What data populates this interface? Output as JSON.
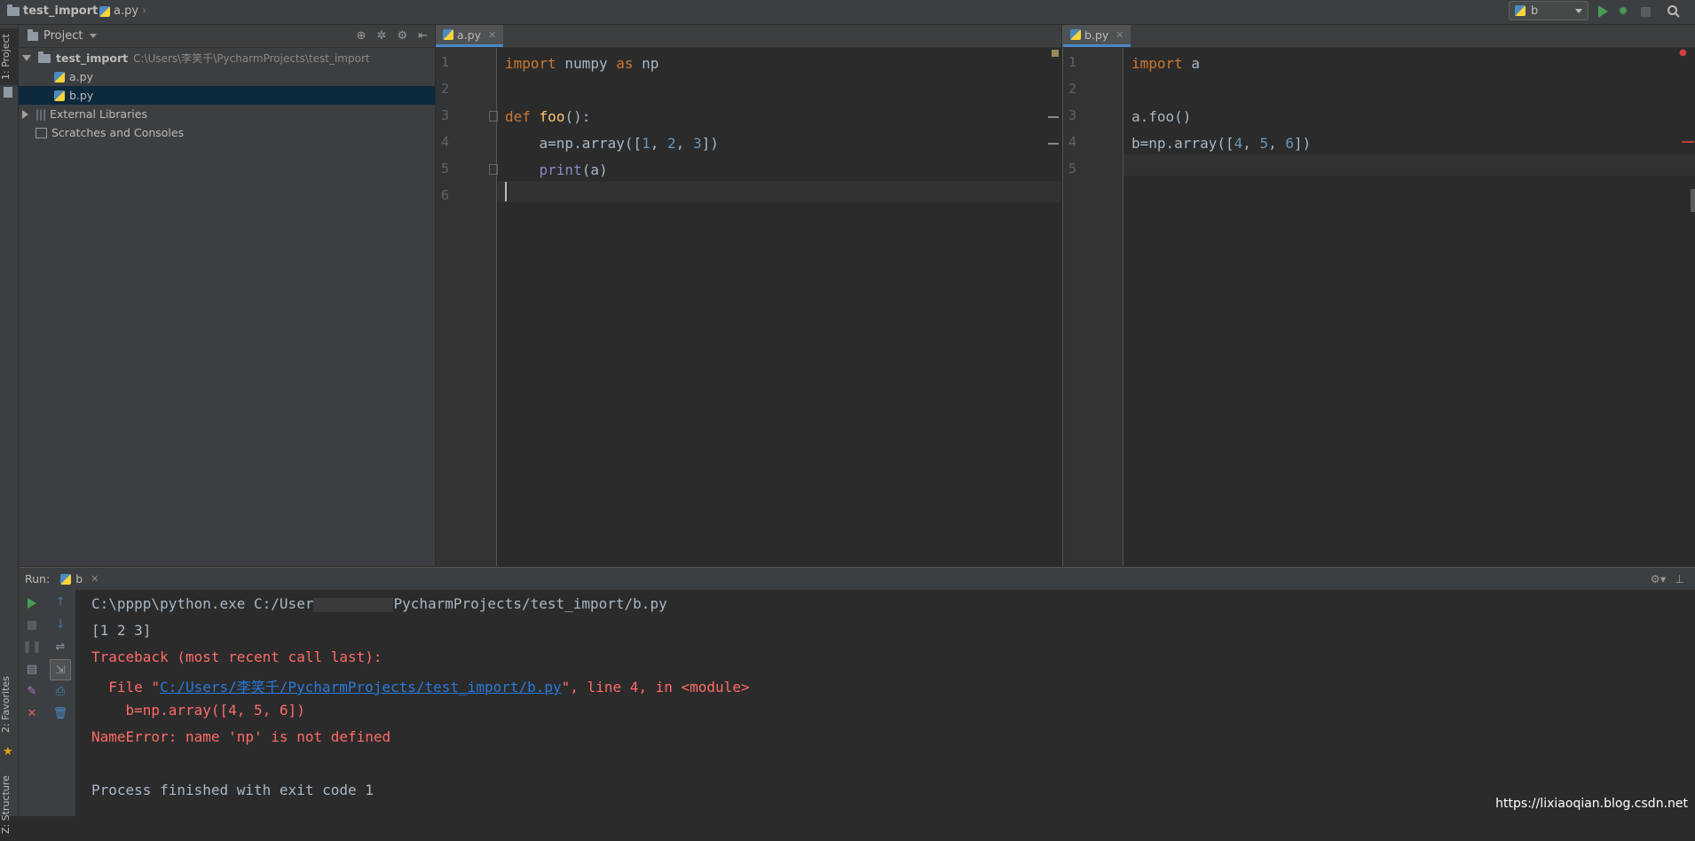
{
  "navbar": {
    "project": "test_import",
    "file": "a.py",
    "run_config": "b"
  },
  "left_strip": {
    "project_tab": "1: Project",
    "favorites_tab": "2: Favorites",
    "structure_tab": "Z: Structure"
  },
  "project_panel": {
    "title": "Project",
    "root_name": "test_import",
    "root_path": "C:\\Users\\李笑千\\PycharmProjects\\test_import",
    "items": [
      {
        "label": "a.py"
      },
      {
        "label": "b.py"
      },
      {
        "label": "External Libraries"
      },
      {
        "label": "Scratches and Consoles"
      }
    ]
  },
  "editor_a": {
    "tab": "a.py",
    "line_numbers": [
      "1",
      "2",
      "3",
      "4",
      "5",
      "6"
    ],
    "code": {
      "l1_kw1": "import",
      "l1_mod": " numpy ",
      "l1_kw2": "as",
      "l1_alias": " np",
      "l3_kw": "def",
      "l3_fn": "foo",
      "l3_rest": "():",
      "l4_pre": "    a=np.array([",
      "l4_n1": "1",
      "l4_sep1": ", ",
      "l4_n2": "2",
      "l4_sep2": ", ",
      "l4_n3": "3",
      "l4_post": "])",
      "l5_pre": "    ",
      "l5_bi": "print",
      "l5_post": "(a)"
    }
  },
  "editor_b": {
    "tab": "b.py",
    "line_numbers": [
      "1",
      "2",
      "3",
      "4",
      "5"
    ],
    "code": {
      "l1_kw": "import",
      "l1_mod": " a",
      "l3": "a.foo()",
      "l4_pre": "b=np.array([",
      "l4_n1": "4",
      "l4_sep1": ", ",
      "l4_n2": "5",
      "l4_sep2": ", ",
      "l4_n3": "6",
      "l4_post": "])"
    }
  },
  "run_panel": {
    "label": "Run:",
    "tab": "b",
    "console": {
      "cmd": "C:\\pppp\\python.exe C:/User",
      "cmd_tail": "PycharmProjects/test_import/b.py",
      "out1": "[1 2 3]",
      "tb1": "Traceback (most recent call last):",
      "tb2_pre": "  File \"",
      "tb2_link": "C:/Users/李笑千/PycharmProjects/test_import/b.py",
      "tb2_post": "\", line 4, in <module>",
      "tb3": "    b=np.array([4, 5, 6])",
      "tb4": "NameError: name 'np' is not defined",
      "exit": "Process finished with exit code 1"
    }
  },
  "watermark": "https://lixiaoqian.blog.csdn.net",
  "colors": {
    "background": "#2b2b2b",
    "panel": "#3c3f41",
    "keyword": "#cc7832",
    "function": "#ffc66d",
    "number": "#6897bb",
    "builtin": "#8888c6",
    "error": "#ff6b68",
    "link": "#287bde",
    "run_green": "#499c54"
  }
}
